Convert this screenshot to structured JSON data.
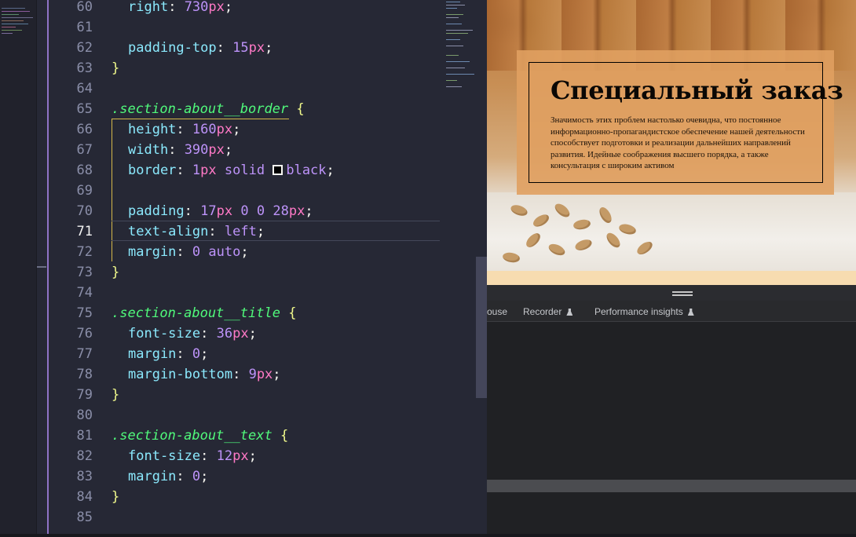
{
  "editor": {
    "line_numbers": [
      "60",
      "61",
      "62",
      "63",
      "64",
      "65",
      "66",
      "67",
      "68",
      "69",
      "70",
      "71",
      "72",
      "73",
      "74",
      "75",
      "76",
      "77",
      "78",
      "79",
      "80",
      "81",
      "82",
      "83",
      "84",
      "85"
    ],
    "active_line": "71",
    "l60": {
      "prop": "right",
      "colon": ":",
      "val": "730",
      "unit": "px",
      "semi": ";"
    },
    "l62": {
      "prop": "padding-top",
      "colon": ":",
      "val": "15",
      "unit": "px",
      "semi": ";"
    },
    "l63": {
      "brace": "}"
    },
    "l65": {
      "selector": ".section-about__border",
      "brace": "{"
    },
    "l66": {
      "prop": "height",
      "colon": ":",
      "val": "160",
      "unit": "px",
      "semi": ";"
    },
    "l67": {
      "prop": "width",
      "colon": ":",
      "val": "390",
      "unit": "px",
      "semi": ";"
    },
    "l68": {
      "prop": "border",
      "colon": ":",
      "val": "1",
      "unit": "px",
      "kw1": "solid",
      "kw2": "black",
      "semi": ";"
    },
    "l70": {
      "prop": "padding",
      "colon": ":",
      "val": "17",
      "unit": "px",
      "v2": "0",
      "v3": "0",
      "v4": "28",
      "unit4": "px",
      "semi": ";"
    },
    "l71": {
      "prop": "text-align",
      "colon": ":",
      "kw": "left",
      "semi": ";"
    },
    "l72": {
      "prop": "margin",
      "colon": ":",
      "v1": "0",
      "kw": "auto",
      "semi": ";"
    },
    "l73": {
      "brace": "}"
    },
    "l75": {
      "selector": ".section-about__title",
      "brace": "{"
    },
    "l76": {
      "prop": "font-size",
      "colon": ":",
      "val": "36",
      "unit": "px",
      "semi": ";"
    },
    "l77": {
      "prop": "margin",
      "colon": ":",
      "val": "0",
      "semi": ";"
    },
    "l78": {
      "prop": "margin-bottom",
      "colon": ":",
      "val": "9",
      "unit": "px",
      "semi": ";"
    },
    "l79": {
      "brace": "}"
    },
    "l81": {
      "selector": ".section-about__text",
      "brace": "{"
    },
    "l82": {
      "prop": "font-size",
      "colon": ":",
      "val": "12",
      "unit": "px",
      "semi": ";"
    },
    "l83": {
      "prop": "margin",
      "colon": ":",
      "val": "0",
      "semi": ";"
    },
    "l84": {
      "brace": "}"
    }
  },
  "preview": {
    "title": "Специальный заказ",
    "text": "Значимость этих проблем настолько очевидна, что постоянное информационно-пропагандистское обеспечение нашей деятельности способствует подготовки и реализации дальнейших направлений развития. Идейные соображения высшего порядка, а также консультация с широким активом"
  },
  "devtools": {
    "tabs": [
      "ouse",
      "Recorder",
      "Performance insights"
    ]
  },
  "colors": {
    "editor_bg": "#262835",
    "selector": "#50fa7b",
    "property": "#8be9fd",
    "number": "#bd93f9",
    "unit": "#ff79c6",
    "brace": "#f1fa8c"
  }
}
